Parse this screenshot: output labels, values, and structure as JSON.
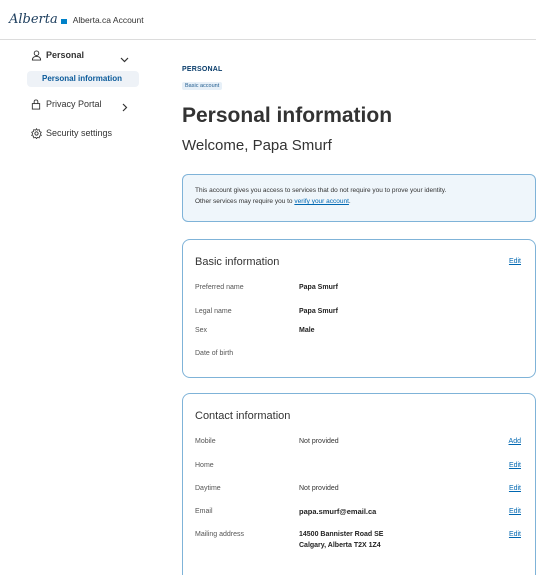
{
  "header": {
    "logo_text": "Alberta",
    "app_title": "Alberta.ca Account"
  },
  "sidebar": {
    "personal_label": "Personal",
    "personal_info_label": "Personal information",
    "privacy_portal_label": "Privacy Portal",
    "security_settings_label": "Security settings"
  },
  "page": {
    "eyebrow": "PERSONAL",
    "tag": "Basic account",
    "title": "Personal information",
    "welcome": "Welcome, Papa Smurf"
  },
  "notice": {
    "line1": "This account gives you access to services that do not require you to prove your identity.",
    "line2_prefix": "Other services may require you to ",
    "link": "verify your account",
    "line2_suffix": "."
  },
  "basic_info": {
    "title": "Basic information",
    "edit": "Edit",
    "rows": [
      {
        "label": "Preferred name",
        "value": "Papa Smurf"
      },
      {
        "label": "Legal name",
        "value": "Papa Smurf"
      },
      {
        "label": "Sex",
        "value": "Male"
      },
      {
        "label": "Date of birth",
        "value": ""
      }
    ]
  },
  "contact_info": {
    "title": "Contact information",
    "rows": [
      {
        "label": "Mobile",
        "value": "Not provided",
        "action": "Add"
      },
      {
        "label": "Home",
        "value": "",
        "action": "Edit"
      },
      {
        "label": "Daytime",
        "value": "Not provided",
        "action": "Edit"
      },
      {
        "label": "Email",
        "value": "papa.smurf@email.ca",
        "action": "Edit"
      },
      {
        "label": "Mailing address",
        "value": "14500 Bannister Road SE",
        "value2": "Calgary, Alberta T2X 1Z4",
        "action": "Edit"
      }
    ]
  }
}
